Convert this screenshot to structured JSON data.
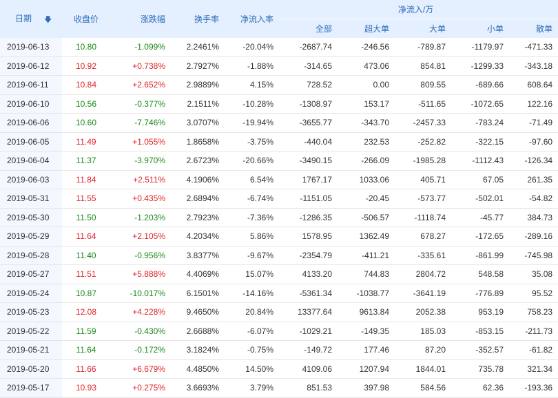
{
  "header": {
    "date": "日期",
    "close": "收盘价",
    "change": "涨跌幅",
    "turnover": "换手率",
    "net_inflow_rate": "净流入率",
    "net_inflow_group": "净流入/万",
    "total": "全部",
    "super_large": "超大单",
    "large": "大单",
    "small": "小单",
    "retail": "散单"
  },
  "colors": {
    "up": "#e0242a",
    "down": "#1a8a1a",
    "header_bg": "#e4efff",
    "header_text": "#2d6db8"
  },
  "rows": [
    {
      "date": "2019-06-13",
      "close": "10.80",
      "change": "-1.099%",
      "turnover": "2.2461%",
      "rate": "-20.04%",
      "total": "-2687.74",
      "super": "-246.56",
      "large": "-789.87",
      "small": "-1179.97",
      "retail": "-471.33",
      "dir": "down"
    },
    {
      "date": "2019-06-12",
      "close": "10.92",
      "change": "+0.738%",
      "turnover": "2.7927%",
      "rate": "-1.88%",
      "total": "-314.65",
      "super": "473.06",
      "large": "854.81",
      "small": "-1299.33",
      "retail": "-343.18",
      "dir": "up"
    },
    {
      "date": "2019-06-11",
      "close": "10.84",
      "change": "+2.652%",
      "turnover": "2.9889%",
      "rate": "4.15%",
      "total": "728.52",
      "super": "0.00",
      "large": "809.55",
      "small": "-689.66",
      "retail": "608.64",
      "dir": "up"
    },
    {
      "date": "2019-06-10",
      "close": "10.56",
      "change": "-0.377%",
      "turnover": "2.1511%",
      "rate": "-10.28%",
      "total": "-1308.97",
      "super": "153.17",
      "large": "-511.65",
      "small": "-1072.65",
      "retail": "122.16",
      "dir": "down"
    },
    {
      "date": "2019-06-06",
      "close": "10.60",
      "change": "-7.746%",
      "turnover": "3.0707%",
      "rate": "-19.94%",
      "total": "-3655.77",
      "super": "-343.70",
      "large": "-2457.33",
      "small": "-783.24",
      "retail": "-71.49",
      "dir": "down"
    },
    {
      "date": "2019-06-05",
      "close": "11.49",
      "change": "+1.055%",
      "turnover": "1.8658%",
      "rate": "-3.75%",
      "total": "-440.04",
      "super": "232.53",
      "large": "-252.82",
      "small": "-322.15",
      "retail": "-97.60",
      "dir": "up"
    },
    {
      "date": "2019-06-04",
      "close": "11.37",
      "change": "-3.970%",
      "turnover": "2.6723%",
      "rate": "-20.66%",
      "total": "-3490.15",
      "super": "-266.09",
      "large": "-1985.28",
      "small": "-1112.43",
      "retail": "-126.34",
      "dir": "down"
    },
    {
      "date": "2019-06-03",
      "close": "11.84",
      "change": "+2.511%",
      "turnover": "4.1906%",
      "rate": "6.54%",
      "total": "1767.17",
      "super": "1033.06",
      "large": "405.71",
      "small": "67.05",
      "retail": "261.35",
      "dir": "up"
    },
    {
      "date": "2019-05-31",
      "close": "11.55",
      "change": "+0.435%",
      "turnover": "2.6894%",
      "rate": "-6.74%",
      "total": "-1151.05",
      "super": "-20.45",
      "large": "-573.77",
      "small": "-502.01",
      "retail": "-54.82",
      "dir": "up"
    },
    {
      "date": "2019-05-30",
      "close": "11.50",
      "change": "-1.203%",
      "turnover": "2.7923%",
      "rate": "-7.36%",
      "total": "-1286.35",
      "super": "-506.57",
      "large": "-1118.74",
      "small": "-45.77",
      "retail": "384.73",
      "dir": "down"
    },
    {
      "date": "2019-05-29",
      "close": "11.64",
      "change": "+2.105%",
      "turnover": "4.2034%",
      "rate": "5.86%",
      "total": "1578.95",
      "super": "1362.49",
      "large": "678.27",
      "small": "-172.65",
      "retail": "-289.16",
      "dir": "up"
    },
    {
      "date": "2019-05-28",
      "close": "11.40",
      "change": "-0.956%",
      "turnover": "3.8377%",
      "rate": "-9.67%",
      "total": "-2354.79",
      "super": "-411.21",
      "large": "-335.61",
      "small": "-861.99",
      "retail": "-745.98",
      "dir": "down"
    },
    {
      "date": "2019-05-27",
      "close": "11.51",
      "change": "+5.888%",
      "turnover": "4.4069%",
      "rate": "15.07%",
      "total": "4133.20",
      "super": "744.83",
      "large": "2804.72",
      "small": "548.58",
      "retail": "35.08",
      "dir": "up"
    },
    {
      "date": "2019-05-24",
      "close": "10.87",
      "change": "-10.017%",
      "turnover": "6.1501%",
      "rate": "-14.16%",
      "total": "-5361.34",
      "super": "-1038.77",
      "large": "-3641.19",
      "small": "-776.89",
      "retail": "95.52",
      "dir": "down"
    },
    {
      "date": "2019-05-23",
      "close": "12.08",
      "change": "+4.228%",
      "turnover": "9.4650%",
      "rate": "20.84%",
      "total": "13377.64",
      "super": "9613.84",
      "large": "2052.38",
      "small": "953.19",
      "retail": "758.23",
      "dir": "up"
    },
    {
      "date": "2019-05-22",
      "close": "11.59",
      "change": "-0.430%",
      "turnover": "2.6688%",
      "rate": "-6.07%",
      "total": "-1029.21",
      "super": "-149.35",
      "large": "185.03",
      "small": "-853.15",
      "retail": "-211.73",
      "dir": "down"
    },
    {
      "date": "2019-05-21",
      "close": "11.64",
      "change": "-0.172%",
      "turnover": "3.1824%",
      "rate": "-0.75%",
      "total": "-149.72",
      "super": "177.46",
      "large": "87.20",
      "small": "-352.57",
      "retail": "-61.82",
      "dir": "down"
    },
    {
      "date": "2019-05-20",
      "close": "11.66",
      "change": "+6.679%",
      "turnover": "4.4850%",
      "rate": "14.50%",
      "total": "4109.06",
      "super": "1207.94",
      "large": "1844.01",
      "small": "735.78",
      "retail": "321.34",
      "dir": "up"
    },
    {
      "date": "2019-05-17",
      "close": "10.93",
      "change": "+0.275%",
      "turnover": "3.6693%",
      "rate": "3.79%",
      "total": "851.53",
      "super": "397.98",
      "large": "584.56",
      "small": "62.36",
      "retail": "-193.36",
      "dir": "up"
    }
  ]
}
